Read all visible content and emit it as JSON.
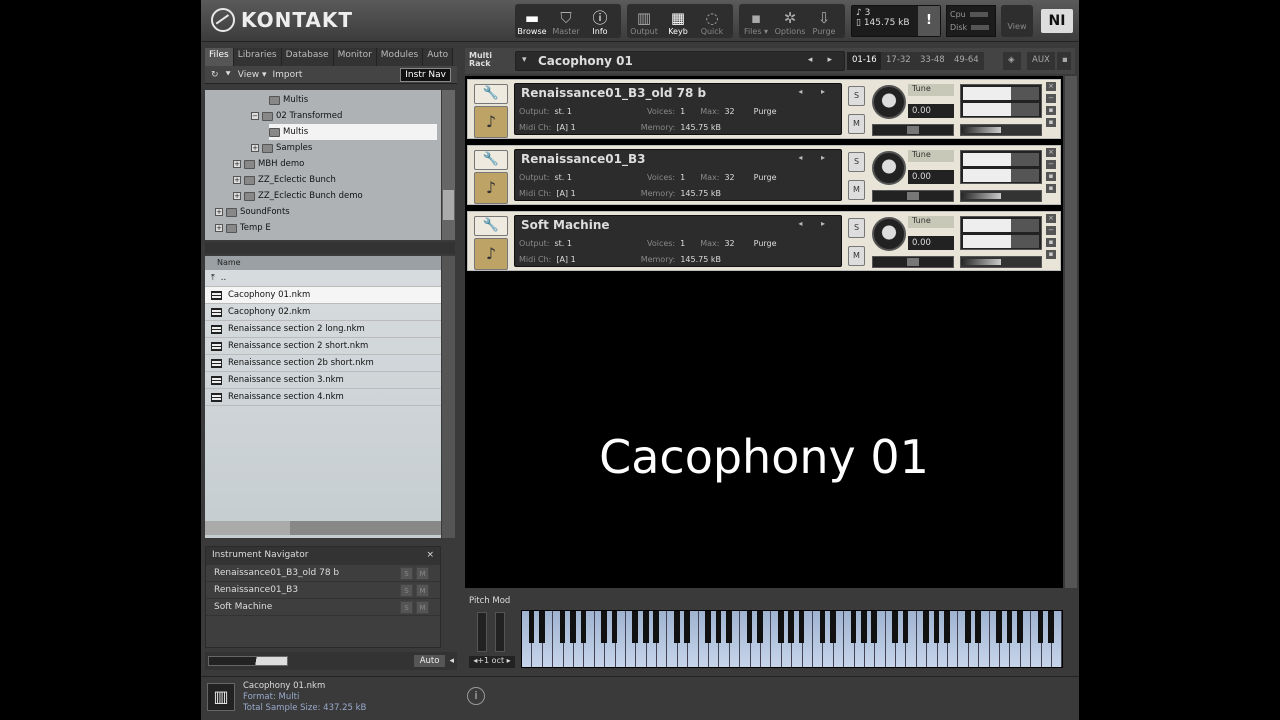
{
  "app": {
    "logo": "KONTAKT"
  },
  "toolbar": {
    "groups": [
      [
        {
          "label": "Browse",
          "icon": "▬",
          "on": true
        },
        {
          "label": "Master",
          "icon": "⛉",
          "on": false
        },
        {
          "label": "Info",
          "icon": "ⓘ",
          "on": true
        }
      ],
      [
        {
          "label": "Output",
          "icon": "▥",
          "on": false
        },
        {
          "label": "Keyb",
          "icon": "▦",
          "on": true
        },
        {
          "label": "Quick",
          "icon": "◌",
          "on": false
        }
      ],
      [
        {
          "label": "Files ▾",
          "icon": "▪",
          "on": false
        },
        {
          "label": "Options",
          "icon": "✲",
          "on": false
        },
        {
          "label": "Purge",
          "icon": "⇩",
          "on": false
        }
      ]
    ],
    "voices": "3",
    "memory": "145.75 kB",
    "alert": "!",
    "cpu_label": "Cpu",
    "disk_label": "Disk",
    "view_label": "View",
    "ni_logo": "NI"
  },
  "browser": {
    "tabs": [
      {
        "label": "Files",
        "on": true
      },
      {
        "label": "Libraries",
        "on": false
      },
      {
        "label": "Database",
        "on": false
      },
      {
        "label": "Monitor",
        "on": false
      },
      {
        "label": "Modules",
        "on": false
      },
      {
        "label": "Auto",
        "on": false
      }
    ],
    "refresh_icon": "↻",
    "menu_icon": "⯆",
    "view_label": "View",
    "view_arrow": "▾",
    "import_label": "Import",
    "instr_nav_label": "Instr Nav",
    "tree": [
      {
        "label": "Multis",
        "level": 4,
        "plus": false,
        "sel": false
      },
      {
        "label": "02 Transformed",
        "level": 3,
        "plus": true,
        "sign": "−",
        "sel": false
      },
      {
        "label": "Multis",
        "level": 4,
        "plus": false,
        "sel": true
      },
      {
        "label": "Samples",
        "level": 3,
        "plus": true,
        "sign": "+",
        "sel": false
      },
      {
        "label": "MBH demo",
        "level": 2,
        "plus": true,
        "sign": "+",
        "sel": false
      },
      {
        "label": "ZZ_Eclectic Bunch",
        "level": 2,
        "plus": true,
        "sign": "+",
        "sel": false
      },
      {
        "label": "ZZ_Eclectic Bunch demo",
        "level": 2,
        "plus": true,
        "sign": "+",
        "sel": false
      },
      {
        "label": "SoundFonts",
        "level": 1,
        "plus": true,
        "sign": "+",
        "sel": false
      },
      {
        "label": "Temp E",
        "level": 1,
        "plus": true,
        "sign": "+",
        "sel": false
      }
    ],
    "file_header": "Name",
    "up_icon": "⤒",
    "up_label": "..",
    "files": [
      {
        "name": "Cacophony 01.nkm",
        "sel": true
      },
      {
        "name": "Cacophony 02.nkm",
        "sel": false
      },
      {
        "name": "Renaissance section 2 long.nkm",
        "sel": false
      },
      {
        "name": "Renaissance section 2 short.nkm",
        "sel": false
      },
      {
        "name": "Renaissance section 2b short.nkm",
        "sel": false
      },
      {
        "name": "Renaissance section 3.nkm",
        "sel": false
      },
      {
        "name": "Renaissance section 4.nkm",
        "sel": false
      }
    ],
    "instrument_navigator": {
      "title": "Instrument Navigator",
      "close": "×",
      "items": [
        "Renaissance01_B3_old 78 b",
        "Renaissance01_B3",
        "Soft Machine"
      ],
      "s_label": "S",
      "m_label": "M"
    },
    "auto_label": "Auto",
    "speaker_icon": "◂"
  },
  "rack": {
    "label_line1": "Multi",
    "label_line2": "Rack",
    "multi_name": "Cacophony 01",
    "dropdown_arrow": "▾",
    "nav_arrows": "◂ ▸",
    "pages": [
      {
        "label": "01-16",
        "on": true
      },
      {
        "label": "17-32",
        "on": false
      },
      {
        "label": "33-48",
        "on": false
      },
      {
        "label": "49-64",
        "on": false
      }
    ],
    "aux_label": "AUX",
    "instruments": [
      {
        "name": "Renaissance01_B3_old 78 b",
        "output": "st. 1",
        "voices": "1",
        "max": "32",
        "purge": "Purge",
        "midi": "[A] 1",
        "memory": "145.75 kB",
        "tune": "Tune",
        "tune_val": "0.00"
      },
      {
        "name": "Renaissance01_B3",
        "output": "st. 1",
        "voices": "1",
        "max": "32",
        "purge": "Purge",
        "midi": "[A] 1",
        "memory": "145.75 kB",
        "tune": "Tune",
        "tune_val": "0.00"
      },
      {
        "name": "Soft Machine",
        "output": "st. 1",
        "voices": "1",
        "max": "32",
        "purge": "Purge",
        "midi": "[A] 1",
        "memory": "145.75 kB",
        "tune": "Tune",
        "tune_val": "0.00"
      }
    ],
    "output_label": "Output:",
    "voices_label": "Voices:",
    "max_label": "Max:",
    "midi_label": "Midi Ch:",
    "memory_label": "Memory:",
    "s_btn": "S",
    "m_btn": "M",
    "wrench_icon": "🔧",
    "instrument_icon": "♪",
    "overlay_title": "Cacophony 01"
  },
  "keyboard": {
    "pitch_mod_label": "Pitch Mod",
    "octave_label": "◂+1 oct ▸",
    "white_keys": 52
  },
  "footer": {
    "file_name": "Cacophony 01.nkm",
    "format_label": "Format:",
    "format": "Multi",
    "size_label": "Total Sample Size:",
    "size": "437.25 kB",
    "keyboard_icon": "▥",
    "info_icon": "i"
  }
}
